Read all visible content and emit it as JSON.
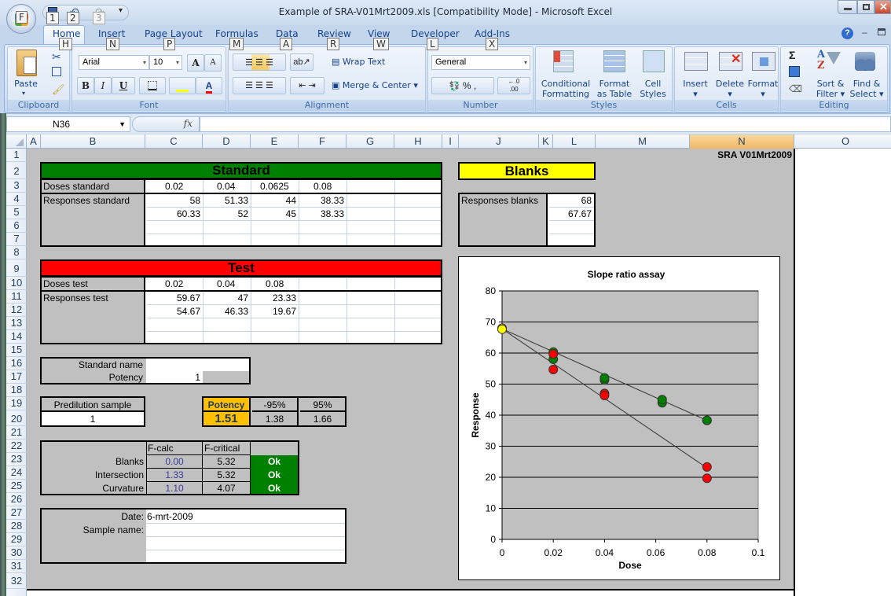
{
  "window": {
    "title": "Example of SRA-V01Mrt2009.xls  [Compatibility Mode] - Microsoft Excel",
    "office_button_keytip": "F",
    "qat_keytips": [
      "1",
      "2",
      "3"
    ]
  },
  "tabs": [
    {
      "label": "Home",
      "keytip": "H",
      "active": true
    },
    {
      "label": "Insert",
      "keytip": "N"
    },
    {
      "label": "Page Layout",
      "keytip": "P"
    },
    {
      "label": "Formulas",
      "keytip": "M"
    },
    {
      "label": "Data",
      "keytip": "A"
    },
    {
      "label": "Review",
      "keytip": "R"
    },
    {
      "label": "View",
      "keytip": "W"
    },
    {
      "label": "Developer",
      "keytip": "L"
    },
    {
      "label": "Add-Ins",
      "keytip": "X"
    }
  ],
  "ribbon": {
    "clipboard": {
      "label": "Clipboard",
      "paste": "Paste"
    },
    "font": {
      "label": "Font",
      "font_name": "Arial",
      "font_size": "10",
      "bold": "B",
      "italic": "I",
      "underline": "U",
      "grow": "A",
      "shrink": "A",
      "font_color_letter": "A"
    },
    "alignment": {
      "label": "Alignment",
      "wrap_text": "Wrap Text",
      "merge_center": "Merge & Center"
    },
    "number": {
      "label": "Number",
      "format": "General",
      "percent": "%",
      "comma": ",",
      "inc_decimal": "←.0 .00",
      "dec_decimal": ".00 →.0"
    },
    "styles": {
      "label": "Styles",
      "conditional_formatting": [
        "Conditional",
        "Formatting ▾"
      ],
      "format_as_table": [
        "Format",
        "as Table ▾"
      ],
      "cell_styles": [
        "Cell",
        "Styles ▾"
      ]
    },
    "cells": {
      "label": "Cells",
      "insert": "Insert",
      "delete": "Delete",
      "format": "Format"
    },
    "editing": {
      "label": "Editing",
      "sum": "Σ",
      "sort_filter": [
        "Sort &",
        "Filter ▾"
      ],
      "find_select": [
        "Find &",
        "Select ▾"
      ]
    }
  },
  "formula_bar": {
    "name_box": "N36",
    "fx": "fx",
    "formula": ""
  },
  "columns": [
    "A",
    "B",
    "C",
    "D",
    "E",
    "F",
    "G",
    "H",
    "I",
    "J",
    "K",
    "L",
    "M",
    "N",
    "O"
  ],
  "selected_column": "N",
  "rows": [
    "1",
    "2",
    "3",
    "4",
    "5",
    "6",
    "7",
    "8",
    "9",
    "10",
    "11",
    "12",
    "13",
    "14",
    "15",
    "16",
    "17",
    "18",
    "19",
    "20",
    "21",
    "22",
    "23",
    "24",
    "25",
    "26",
    "27",
    "28",
    "29",
    "30",
    "31",
    "32"
  ],
  "version_label": "SRA V01Mrt2009",
  "standard": {
    "title": "Standard",
    "doses_label": "Doses standard",
    "doses": [
      "0.02",
      "0.04",
      "0.0625",
      "0.08"
    ],
    "responses_label": "Responses standard",
    "responses": [
      [
        "58",
        "51.33",
        "44",
        "38.33"
      ],
      [
        "60.33",
        "52",
        "45",
        "38.33"
      ]
    ]
  },
  "test": {
    "title": "Test",
    "doses_label": "Doses test",
    "doses": [
      "0.02",
      "0.04",
      "0.08"
    ],
    "responses_label": "Responses test",
    "responses": [
      [
        "59.67",
        "47",
        "23.33"
      ],
      [
        "54.67",
        "46.33",
        "19.67"
      ]
    ]
  },
  "blanks": {
    "title": "Blanks",
    "responses_label": "Responses blanks",
    "responses": [
      "68",
      "67.67"
    ]
  },
  "standard_info": {
    "name_label": "Standard name",
    "name_value": "",
    "potency_label": "Potency",
    "potency_value": "1"
  },
  "predilution": {
    "label": "Predilution sample",
    "value": "1"
  },
  "potency_result": {
    "label": "Potency",
    "value": "1.51",
    "low_label": "-95%",
    "low": "1.38",
    "high_label": "95%",
    "high": "1.66"
  },
  "ftests": {
    "headers": [
      "F-calc",
      "F-critical"
    ],
    "rows": [
      {
        "label": "Blanks",
        "fcalc": "0.00",
        "fcrit": "5.32",
        "status": "Ok"
      },
      {
        "label": "Intersection",
        "fcalc": "1.33",
        "fcrit": "5.32",
        "status": "Ok"
      },
      {
        "label": "Curvature",
        "fcalc": "1.10",
        "fcrit": "4.07",
        "status": "Ok"
      }
    ]
  },
  "sample_info": {
    "date_label": "Date:",
    "date_value": "6-mrt-2009",
    "sample_label": "Sample name:",
    "sample_value": ""
  },
  "colors": {
    "standard": "#008000",
    "test": "#ff0000",
    "blanks": "#ffff00",
    "potency": "#ffc000",
    "ok": "#008000"
  },
  "chart_data": {
    "type": "scatter",
    "title": "Slope ratio assay",
    "xlabel": "Dose",
    "ylabel": "Response",
    "xlim": [
      0,
      0.1
    ],
    "ylim": [
      0,
      80
    ],
    "xticks": [
      "0",
      "0.02",
      "0.04",
      "0.06",
      "0.08",
      "0.1"
    ],
    "yticks": [
      "0",
      "10",
      "20",
      "30",
      "40",
      "50",
      "60",
      "70",
      "80"
    ],
    "grid": "horizontal",
    "series": [
      {
        "name": "Standard",
        "color": "#008000",
        "x": [
          0.02,
          0.04,
          0.0625,
          0.08,
          0.02,
          0.04,
          0.0625,
          0.08
        ],
        "y": [
          58,
          51.33,
          44,
          38.33,
          60.33,
          52,
          45,
          38.33
        ]
      },
      {
        "name": "Test",
        "color": "#ff0000",
        "x": [
          0.02,
          0.04,
          0.08,
          0.02,
          0.04,
          0.08
        ],
        "y": [
          59.67,
          47,
          23.33,
          54.67,
          46.33,
          19.67
        ]
      },
      {
        "name": "Blanks",
        "color": "#ffff00",
        "x": [
          0,
          0
        ],
        "y": [
          68,
          67.67
        ]
      }
    ],
    "fit_lines": [
      {
        "name": "Standard fit",
        "x": [
          0,
          0.08
        ],
        "y": [
          67.8,
          38.3
        ]
      },
      {
        "name": "Test fit",
        "x": [
          0,
          0.08
        ],
        "y": [
          67.8,
          23.0
        ]
      }
    ]
  }
}
